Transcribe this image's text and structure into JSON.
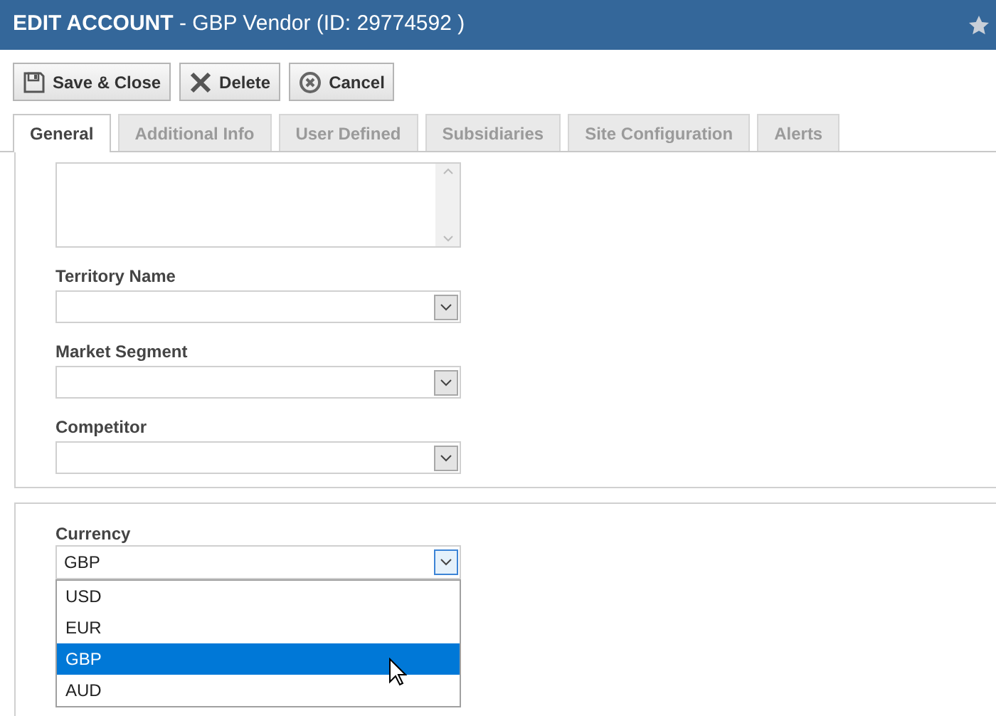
{
  "window": {
    "title_bold": "EDIT ACCOUNT",
    "title_rest": " - GBP Vendor (ID: 29774592 )",
    "favorite": false
  },
  "toolbar": [
    {
      "label": "Save & Close",
      "kind": "save"
    },
    {
      "label": "Delete",
      "kind": "delete"
    },
    {
      "label": "Cancel",
      "kind": "cancel"
    }
  ],
  "tabs": [
    {
      "label": "General",
      "selected": true
    },
    {
      "label": "Additional Info",
      "selected": false
    },
    {
      "label": "User Defined",
      "selected": false
    },
    {
      "label": "Subsidiaries",
      "selected": false
    },
    {
      "label": "Site Configuration",
      "selected": false
    },
    {
      "label": "Alerts",
      "selected": false
    }
  ],
  "fields": [
    {
      "label": "Territory Name"
    },
    {
      "label": "Market Segment"
    },
    {
      "label": "Competitor"
    }
  ],
  "currency": {
    "label": "Currency",
    "value": "GBP",
    "expanded": true,
    "options": [
      {
        "label": "USD",
        "selected": false
      },
      {
        "label": "EUR",
        "selected": false
      },
      {
        "label": "GBP",
        "selected": true
      },
      {
        "label": "AUD",
        "selected": false
      }
    ]
  }
}
